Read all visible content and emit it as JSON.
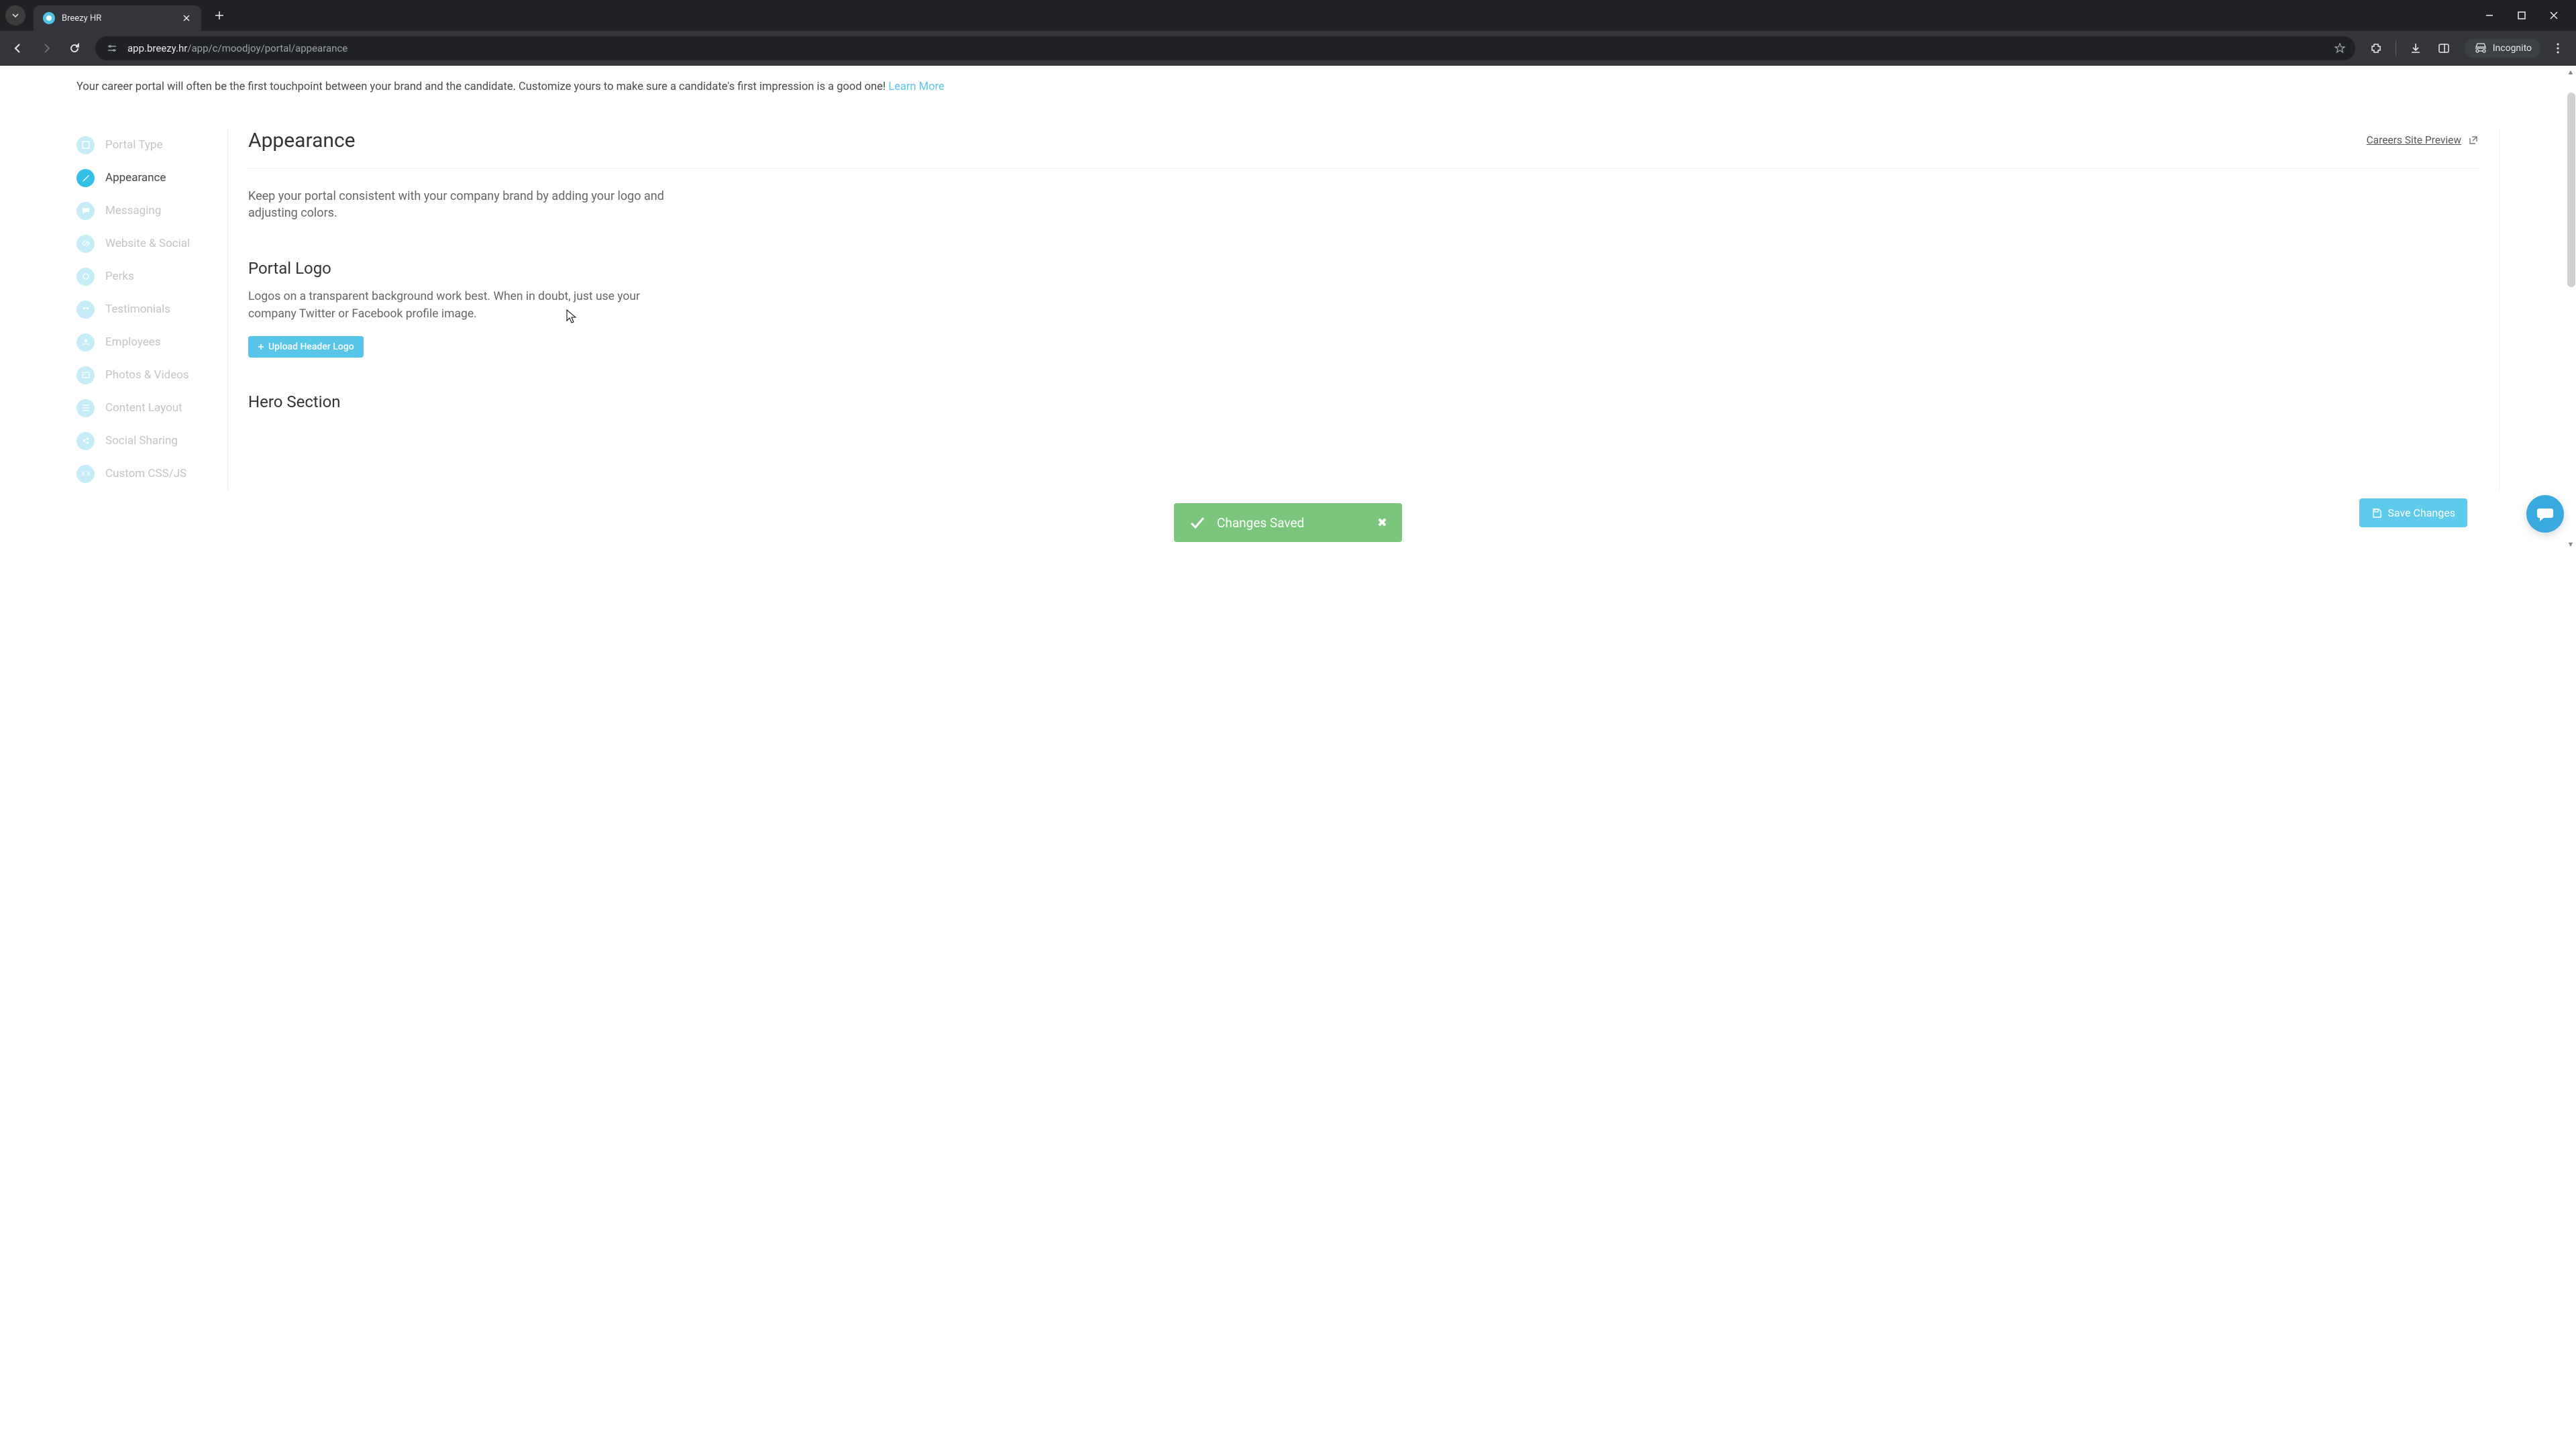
{
  "browser": {
    "tab_title": "Breezy HR",
    "url_host": "app.breezy.hr",
    "url_path": "/app/c/moodjoy/portal/appearance",
    "incognito_label": "Incognito"
  },
  "intro": {
    "text": "Your career portal will often be the first touchpoint between your brand and the candidate. Customize yours to make sure a candidate's first impression is a good one! ",
    "learn_more": "Learn More"
  },
  "sidebar": {
    "items": [
      {
        "label": "Portal Type",
        "active": false
      },
      {
        "label": "Appearance",
        "active": true
      },
      {
        "label": "Messaging",
        "active": false
      },
      {
        "label": "Website & Social",
        "active": false
      },
      {
        "label": "Perks",
        "active": false
      },
      {
        "label": "Testimonials",
        "active": false
      },
      {
        "label": "Employees",
        "active": false
      },
      {
        "label": "Photos & Videos",
        "active": false
      },
      {
        "label": "Content Layout",
        "active": false
      },
      {
        "label": "Social Sharing",
        "active": false
      },
      {
        "label": "Custom CSS/JS",
        "active": false
      }
    ]
  },
  "main": {
    "title": "Appearance",
    "preview_label": "Careers Site Preview",
    "description": "Keep your portal consistent with your company brand by adding your logo and adjusting colors.",
    "logo_section_title": "Portal Logo",
    "logo_section_desc": "Logos on a transparent background work best. When in doubt, just use your company Twitter or Facebook profile image.",
    "upload_label": "Upload Header Logo",
    "hero_section_title": "Hero Section"
  },
  "toast": {
    "message": "Changes Saved"
  },
  "save_button": "Save Changes"
}
